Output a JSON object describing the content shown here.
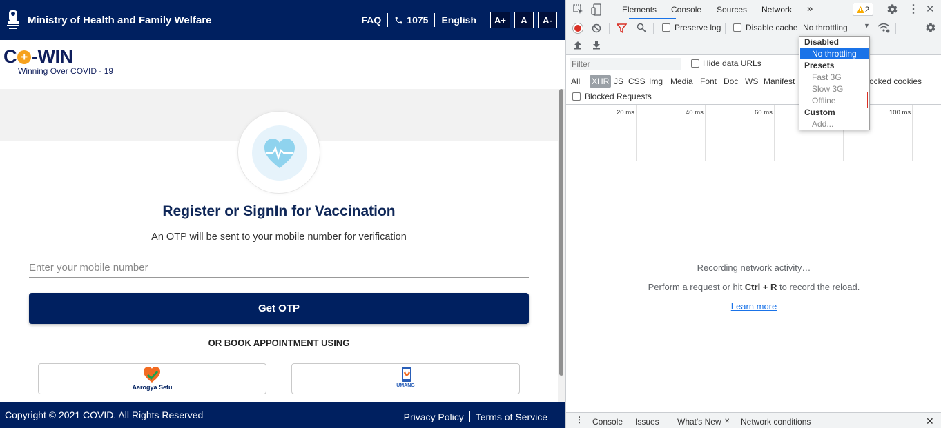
{
  "page": {
    "header": {
      "ministry": "Ministry of Health and Family Welfare",
      "faq": "FAQ",
      "phone": "1075",
      "language": "English",
      "font_controls": [
        "A+",
        "A",
        "A-"
      ]
    },
    "brand": {
      "logo_left": "C",
      "logo_plus": "+",
      "logo_right": "-WIN",
      "tagline": "Winning Over COVID - 19"
    },
    "form": {
      "title": "Register or SignIn for Vaccination",
      "subtitle": "An OTP will be sent to your mobile number for verification",
      "mobile_placeholder": "Enter your mobile number",
      "submit_label": "Get OTP",
      "divider_text": "OR BOOK APPOINTMENT USING",
      "apps": [
        {
          "label": "Aarogya Setu",
          "icon": "aarogya-setu-heart-icon"
        },
        {
          "label": "UMANG",
          "icon": "umang-phone-icon"
        }
      ]
    },
    "footer": {
      "copyright": "Copyright © 2021 COVID. All Rights Reserved",
      "privacy": "Privacy Policy",
      "terms": "Terms of Service"
    }
  },
  "devtools": {
    "tabs": [
      "Elements",
      "Console",
      "Sources",
      "Network"
    ],
    "active_tab": "Network",
    "more_tabs": "»",
    "warnings_count": "2",
    "toolbar": {
      "preserve_log": "Preserve log",
      "disable_cache": "Disable cache",
      "throttling": "No throttling"
    },
    "filter": {
      "placeholder": "Filter",
      "hide_data_urls": "Hide data URLs",
      "types": [
        "All",
        "XHR",
        "JS",
        "CSS",
        "Img",
        "Media",
        "Font",
        "Doc",
        "WS",
        "Manifest"
      ],
      "active_type": "XHR",
      "blocked_cookies": "ocked cookies",
      "blocked_requests": "Blocked Requests"
    },
    "timeline_labels": [
      "20 ms",
      "40 ms",
      "60 ms",
      "100 ms"
    ],
    "empty": {
      "recording": "Recording network activity…",
      "hint_pre": "Perform a request or hit ",
      "hint_keys": "Ctrl + R",
      "hint_post": " to record the reload.",
      "learn_more": "Learn more"
    },
    "throttle_menu": {
      "group_disabled": "Disabled",
      "opt_no_throttling": "No throttling",
      "group_presets": "Presets",
      "opt_fast3g": "Fast 3G",
      "opt_slow3g": "Slow 3G",
      "opt_offline": "Offline",
      "group_custom": "Custom",
      "opt_add": "Add..."
    },
    "drawer_tabs": [
      "Console",
      "Issues",
      "What's New",
      "Network conditions"
    ]
  },
  "colors": {
    "navy": "#002060",
    "accent_orange": "#f6a21e",
    "devtools_blue": "#1a73e8",
    "record_red": "#d93025"
  }
}
